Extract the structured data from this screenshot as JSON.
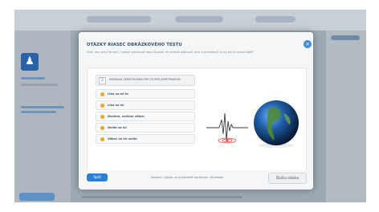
{
  "modal": {
    "title": "Otázky RIASEC obrázkového testu",
    "subtitle": "Zvoľ, ako veľmi ťa baví / nebaví vykonávať danú činnosť. Ak neviete odpoveď, skús si predstaviť, že by ste to museli robiť.",
    "close_icon": "close-icon"
  },
  "question": {
    "number": "2",
    "text": "Zmeranie zemetrasenia pre stupeň zemetrasenia",
    "options": [
      {
        "label": "Lika sa mi to"
      },
      {
        "label": "Lika sa mi"
      },
      {
        "label": "Neviem, neviem vôbec"
      },
      {
        "label": "Nelíbí sa mi"
      },
      {
        "label": "Vôbec sa mi nelíbí"
      }
    ]
  },
  "footer": {
    "back_label": "Späť",
    "info": "Zostáva 1 otázka, ak je potrebné (správnych: 48 otázok)",
    "next_label": "Ďalšia otázka"
  },
  "colors": {
    "accent": "#2f7fd0",
    "option_dot": "#f3a21d",
    "title": "#2f4f74"
  }
}
